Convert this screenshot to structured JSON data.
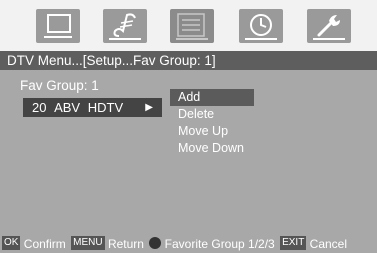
{
  "menu_tabs": [
    {
      "icon": "monitor-icon"
    },
    {
      "icon": "music-note-icon"
    },
    {
      "icon": "settings-sliders-icon",
      "active": true
    },
    {
      "icon": "clock-icon"
    },
    {
      "icon": "wrench-icon"
    }
  ],
  "breadcrumb": "DTV Menu...[Setup...Fav Group: 1]",
  "fav_group": {
    "label": "Fav Group:",
    "number": "1",
    "channel_number": "20",
    "channel_name": "ABV",
    "channel_type": "HDTV"
  },
  "popup_menu": {
    "items": [
      "Add",
      "Delete",
      "Move Up",
      "Move Down"
    ],
    "selected_index": 0
  },
  "help_bar": {
    "ok_key": "OK",
    "ok_text": "Confirm",
    "menu_key": "MENU",
    "menu_text": "Return",
    "dot_text": "Favorite Group 1/2/3",
    "exit_key": "EXIT",
    "exit_text": "Cancel"
  },
  "colors": {
    "panel_bg": "#a8a8a8",
    "crumb_bg": "#5e5e5e",
    "highlight": "#444444",
    "icon_tile": "#9a9a9a"
  }
}
